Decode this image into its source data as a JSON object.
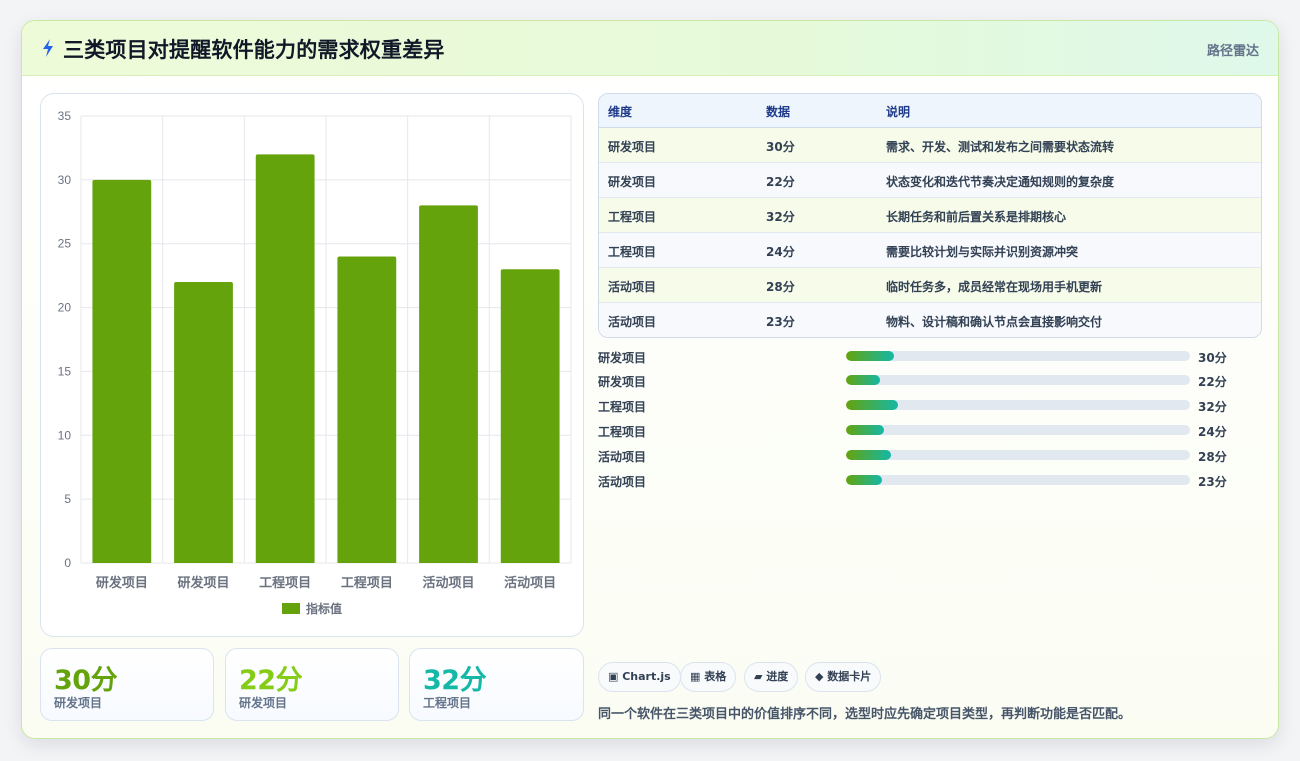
{
  "header": {
    "title": "三类项目对提醒软件能力的需求权重差异",
    "tag": "路径雷达",
    "icon": "lightning-icon"
  },
  "chart_data": {
    "type": "bar",
    "categories": [
      "研发项目",
      "研发项目",
      "工程项目",
      "工程项目",
      "活动项目",
      "活动项目"
    ],
    "series": [
      {
        "name": "指标值",
        "values": [
          30,
          22,
          32,
          24,
          28,
          23
        ]
      }
    ],
    "ylim": [
      0,
      35
    ],
    "yticks": [
      0,
      5,
      10,
      15,
      20,
      25,
      30,
      35
    ],
    "grid": true,
    "legend": "bottom",
    "color": "#65a30d"
  },
  "stats": [
    {
      "value": "30分",
      "label": "研发项目",
      "color": "#65a30d"
    },
    {
      "value": "22分",
      "label": "研发项目",
      "color": "#84cc16"
    },
    {
      "value": "32分",
      "label": "工程项目",
      "color": "#14b8a6"
    }
  ],
  "table": {
    "headers": [
      "维度",
      "数据",
      "说明"
    ],
    "rows": [
      [
        "研发项目",
        "30分",
        "需求、开发、测试和发布之间需要状态流转"
      ],
      [
        "研发项目",
        "22分",
        "状态变化和迭代节奏决定通知规则的复杂度"
      ],
      [
        "工程项目",
        "32分",
        "长期任务和前后置关系是排期核心"
      ],
      [
        "工程项目",
        "24分",
        "需要比较计划与实际并识别资源冲突"
      ],
      [
        "活动项目",
        "28分",
        "临时任务多，成员经常在现场用手机更新"
      ],
      [
        "活动项目",
        "23分",
        "物料、设计稿和确认节点会直接影响交付"
      ]
    ]
  },
  "progress": [
    {
      "label": "研发项目",
      "value": "30分",
      "fraction": 0.14
    },
    {
      "label": "研发项目",
      "value": "22分",
      "fraction": 0.1
    },
    {
      "label": "工程项目",
      "value": "32分",
      "fraction": 0.15
    },
    {
      "label": "工程项目",
      "value": "24分",
      "fraction": 0.11
    },
    {
      "label": "活动项目",
      "value": "28分",
      "fraction": 0.13
    },
    {
      "label": "活动项目",
      "value": "23分",
      "fraction": 0.105
    }
  ],
  "chips": [
    "▣ Chart.js",
    "▦ 表格",
    "▰ 进度",
    "◆ 数据卡片"
  ],
  "footnote": "同一个软件在三类项目中的价值排序不同，选型时应先确定项目类型，再判断功能是否匹配。"
}
